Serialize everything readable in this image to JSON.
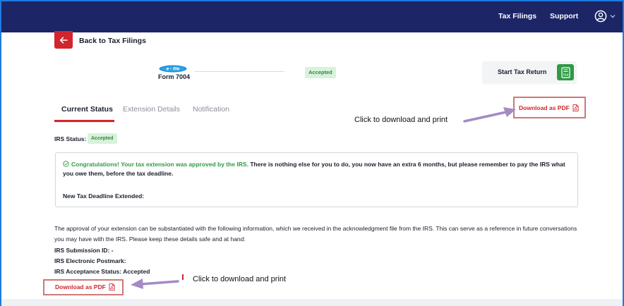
{
  "header": {
    "nav": [
      {
        "label": "Tax Filings"
      },
      {
        "label": "Support"
      }
    ],
    "avatar_icon": "user-circle-icon",
    "avatar_chevron_icon": "chevron-down-icon",
    "background": "#1c2566"
  },
  "back": {
    "icon": "arrow-left-icon",
    "label": "Back to Tax Filings",
    "color": "#d2252e"
  },
  "filing": {
    "logo_text": "e - file",
    "form_label": "Form 7004",
    "status_badge": "Accepted"
  },
  "start_return": {
    "label": "Start Tax Return",
    "icon": "tax-form-icon",
    "icon_color": "#2f9a45"
  },
  "tabs": [
    {
      "label": "Current Status",
      "active": true
    },
    {
      "label": "Extension Details",
      "active": false
    },
    {
      "label": "Notification",
      "active": false
    }
  ],
  "download": {
    "top_label": "Download as PDF",
    "bottom_label": "Download as PDF",
    "icon": "pdf-file-icon",
    "color": "#d2252e"
  },
  "annotations": {
    "top_callout": "Click to download and print",
    "bottom_callout": "Click to download and print",
    "arrow_color": "#a48bc4",
    "box_color": "#d07777"
  },
  "irs_status": {
    "label": "IRS Status:",
    "badge": "Accepted"
  },
  "congrats": {
    "icon": "check-circle-icon",
    "highlight": "Congratulations! Your tax extension was approved by the IRS.",
    "body": " There is nothing else for you to do, you now have an extra 6 months, but please remember to pay the IRS what you owe them, before the tax deadline.",
    "deadline_label": "New Tax Deadline Extended:"
  },
  "info": {
    "paragraph": "The approval of your extension can be substantiated with the following information, which we received in the acknowledgment file from the IRS. This can serve as a reference in future conversations you may have with the IRS. Please keep these details safe and at hand:",
    "submission_id": "IRS Submission ID: -",
    "postmark": "IRS Electronic Postmark:",
    "acceptance": "IRS Acceptance Status: Accepted"
  }
}
